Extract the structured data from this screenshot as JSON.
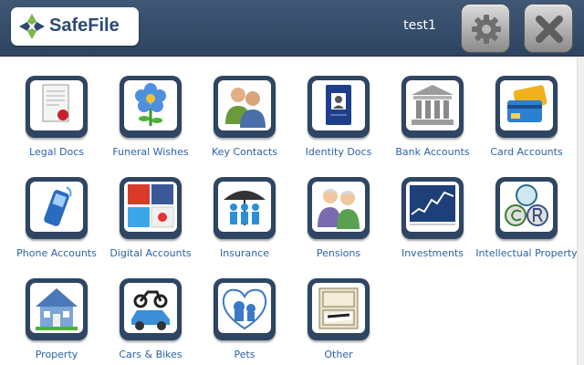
{
  "header": {
    "brand": "SafeFile",
    "username": "test1",
    "settings_icon": "gear-icon",
    "close_icon": "close-icon"
  },
  "colors": {
    "header_bg": "#34506f",
    "tile_frame": "#2e4563",
    "label_text": "#2a63a8"
  },
  "tiles": [
    {
      "label": "Legal Docs",
      "icon": "legal-document-icon"
    },
    {
      "label": "Funeral Wishes",
      "icon": "flower-icon"
    },
    {
      "label": "Key Contacts",
      "icon": "people-icon"
    },
    {
      "label": "Identity Docs",
      "icon": "passport-icon"
    },
    {
      "label": "Bank Accounts",
      "icon": "bank-icon"
    },
    {
      "label": "Card Accounts",
      "icon": "credit-cards-icon"
    },
    {
      "label": "Phone Accounts",
      "icon": "mobile-phone-icon"
    },
    {
      "label": "Digital Accounts",
      "icon": "social-media-icon"
    },
    {
      "label": "Insurance",
      "icon": "umbrella-people-icon"
    },
    {
      "label": "Pensions",
      "icon": "elderly-couple-icon"
    },
    {
      "label": "Investments",
      "icon": "stock-chart-icon"
    },
    {
      "label": "Intellectual Property",
      "icon": "trademark-copyright-icon"
    },
    {
      "label": "Property",
      "icon": "house-icon"
    },
    {
      "label": "Cars & Bikes",
      "icon": "car-motorbike-icon"
    },
    {
      "label": "Pets",
      "icon": "pets-icon"
    },
    {
      "label": "Other",
      "icon": "filing-cabinet-icon"
    }
  ]
}
